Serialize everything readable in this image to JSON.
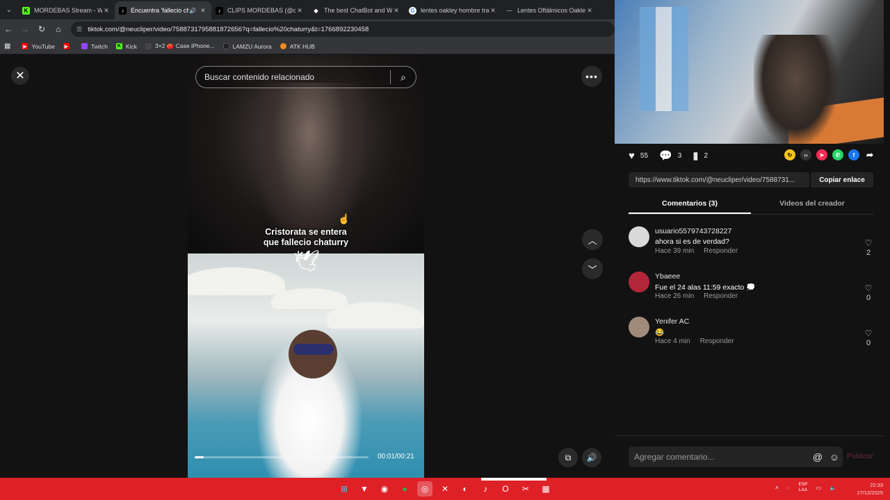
{
  "browser": {
    "tabs": [
      {
        "label": "MORDEBAS Stream - Wat",
        "favicon": "kick-icon",
        "color": "#53fc18"
      },
      {
        "label": "Encuentra 'fallecio ch",
        "favicon": "tiktok-icon",
        "color": "#000000",
        "active": true
      },
      {
        "label": "CLIPS MORDEBAS (@clip",
        "favicon": "tiktok-icon",
        "color": "#000000"
      },
      {
        "label": "The best ChatBot and Wi",
        "favicon": "chatbot-icon",
        "color": "#ffffff"
      },
      {
        "label": "lentes oakley hombre tra",
        "favicon": "google-icon",
        "color": "#ffffff"
      },
      {
        "label": "Lentes Oftálmicos Oakley",
        "favicon": "generic-icon",
        "color": "#888888"
      }
    ],
    "url": "tiktok.com/@neucliper/video/7588731795881872656?q=fallecio%20chaturry&t=1766892230458",
    "bookmarks": [
      {
        "label": "YouTube",
        "color": "#ff0000"
      },
      {
        "label": "",
        "color": "#ff0000"
      },
      {
        "label": "Twitch",
        "color": "#9146ff"
      },
      {
        "label": "Kick",
        "color": "#53fc18"
      },
      {
        "label": "3×2 🍅 Case iPhone...",
        "color": "#444444"
      },
      {
        "label": "LAMZU Aurora",
        "color": "#222222"
      },
      {
        "label": "ATK HUB",
        "color": "#f08a24"
      }
    ]
  },
  "video": {
    "search_placeholder": "Buscar contenido relacionado",
    "caption_line1": "Cristorata se entera",
    "caption_line2": "que fallecio chaturry",
    "time": "00:01/00:21",
    "progress": 0.05
  },
  "panel": {
    "likes": "55",
    "comments_count": "3",
    "saves": "2",
    "link": "https://www.tiktok.com/@neucliper/video/7588731...",
    "copy_label": "Copiar enlace",
    "tab_comments": "Comentarios (3)",
    "tab_videos": "Videos del creador",
    "comments": [
      {
        "user": "usuario5579743728227",
        "text": "ahora si es de verdad?",
        "time": "Hace 39 min",
        "reply": "Responder",
        "likes": "2",
        "avatar_color": "#d9d9d9"
      },
      {
        "user": "Ybaeee",
        "text": "Fue el 24 alas 11:59 exacto 💭",
        "time": "Hace 26 min",
        "reply": "Responder",
        "likes": "0",
        "avatar_color": "#b3263a"
      },
      {
        "user": "Yenifer AC",
        "text": "😂",
        "time": "Hace 4 min",
        "reply": "Responder",
        "likes": "0",
        "avatar_color": "#a08a7a"
      }
    ],
    "comment_placeholder": "Agregar comentario...",
    "publish_label": "Publicar"
  },
  "taskbar": {
    "lang_line1": "ESP",
    "lang_line2": "LAA",
    "clock_time": "22:33",
    "clock_date": "27/12/2025"
  }
}
